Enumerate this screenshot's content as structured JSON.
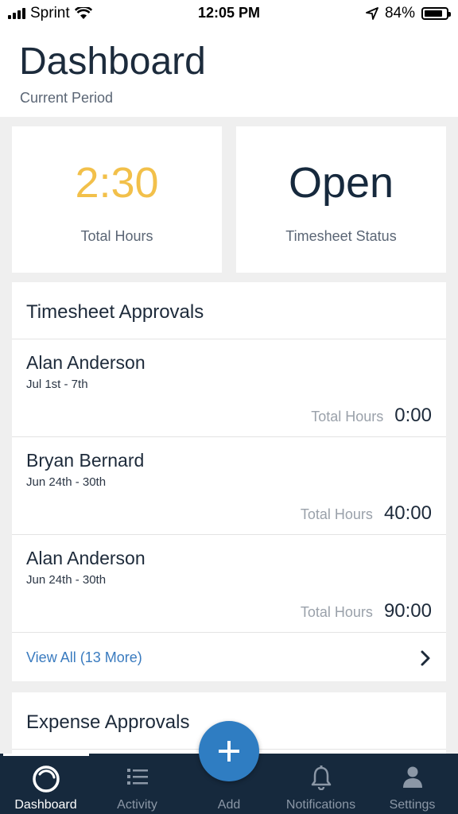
{
  "status_bar": {
    "carrier": "Sprint",
    "time": "12:05 PM",
    "battery_percent": "84%",
    "battery_level": 0.84
  },
  "header": {
    "title": "Dashboard",
    "subtitle": "Current Period"
  },
  "stats": {
    "total_hours_value": "2:30",
    "total_hours_label": "Total Hours",
    "status_value": "Open",
    "status_label": "Timesheet Status"
  },
  "timesheet_approvals": {
    "title": "Timesheet Approvals",
    "rows": [
      {
        "name": "Alan Anderson",
        "dates": "Jul 1st - 7th",
        "total_label": "Total Hours",
        "total_value": "0:00"
      },
      {
        "name": "Bryan Bernard",
        "dates": "Jun 24th - 30th",
        "total_label": "Total Hours",
        "total_value": "40:00"
      },
      {
        "name": "Alan Anderson",
        "dates": "Jun 24th - 30th",
        "total_label": "Total Hours",
        "total_value": "90:00"
      }
    ],
    "view_all": "View All (13 More)"
  },
  "expense_approvals": {
    "title": "Expense Approvals"
  },
  "tabs": [
    {
      "label": "Dashboard",
      "icon": "dashboard-ring-icon",
      "active": true
    },
    {
      "label": "Activity",
      "icon": "list-icon",
      "active": false
    },
    {
      "label": "Add",
      "icon": "plus-icon",
      "active": false
    },
    {
      "label": "Notifications",
      "icon": "bell-icon",
      "active": false
    },
    {
      "label": "Settings",
      "icon": "person-icon",
      "active": false
    }
  ],
  "colors": {
    "accent_yellow": "#f2c04a",
    "link_blue": "#3a7bbf",
    "tabbar_navy": "#16293d",
    "fab_blue": "#2f7dc2"
  }
}
